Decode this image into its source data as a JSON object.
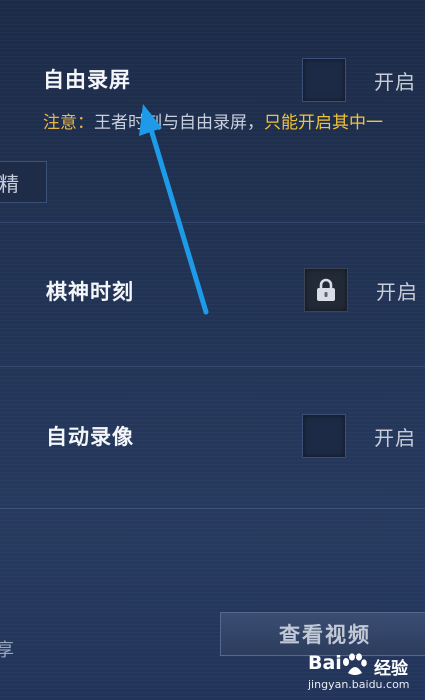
{
  "settings": {
    "free_record": {
      "label": "自由录屏",
      "toggle_label": "开启"
    },
    "notice": {
      "head": "注意：",
      "body": "王者时刻与自由录屏，",
      "tail": "只能开启其中一"
    },
    "sidebar_tab_fragment": "精",
    "chess_moment": {
      "label": "棋神时刻",
      "toggle_label": "开启",
      "locked": true
    },
    "auto_record": {
      "label": "自动录像",
      "toggle_label": "开启"
    }
  },
  "footer": {
    "share_fragment": "享",
    "view_video_label": "查看视频"
  },
  "watermark": {
    "brand_left": "Bai",
    "brand_right": "经验",
    "url": "jingyan.baidu.com"
  },
  "colors": {
    "background": "#22345a",
    "notice_yellow": "#f0c23a",
    "arrow_blue": "#1e9be8"
  },
  "icons": {
    "lock": "lock-icon",
    "arrow": "annotation-arrow-icon",
    "paw": "baidu-paw-icon"
  }
}
